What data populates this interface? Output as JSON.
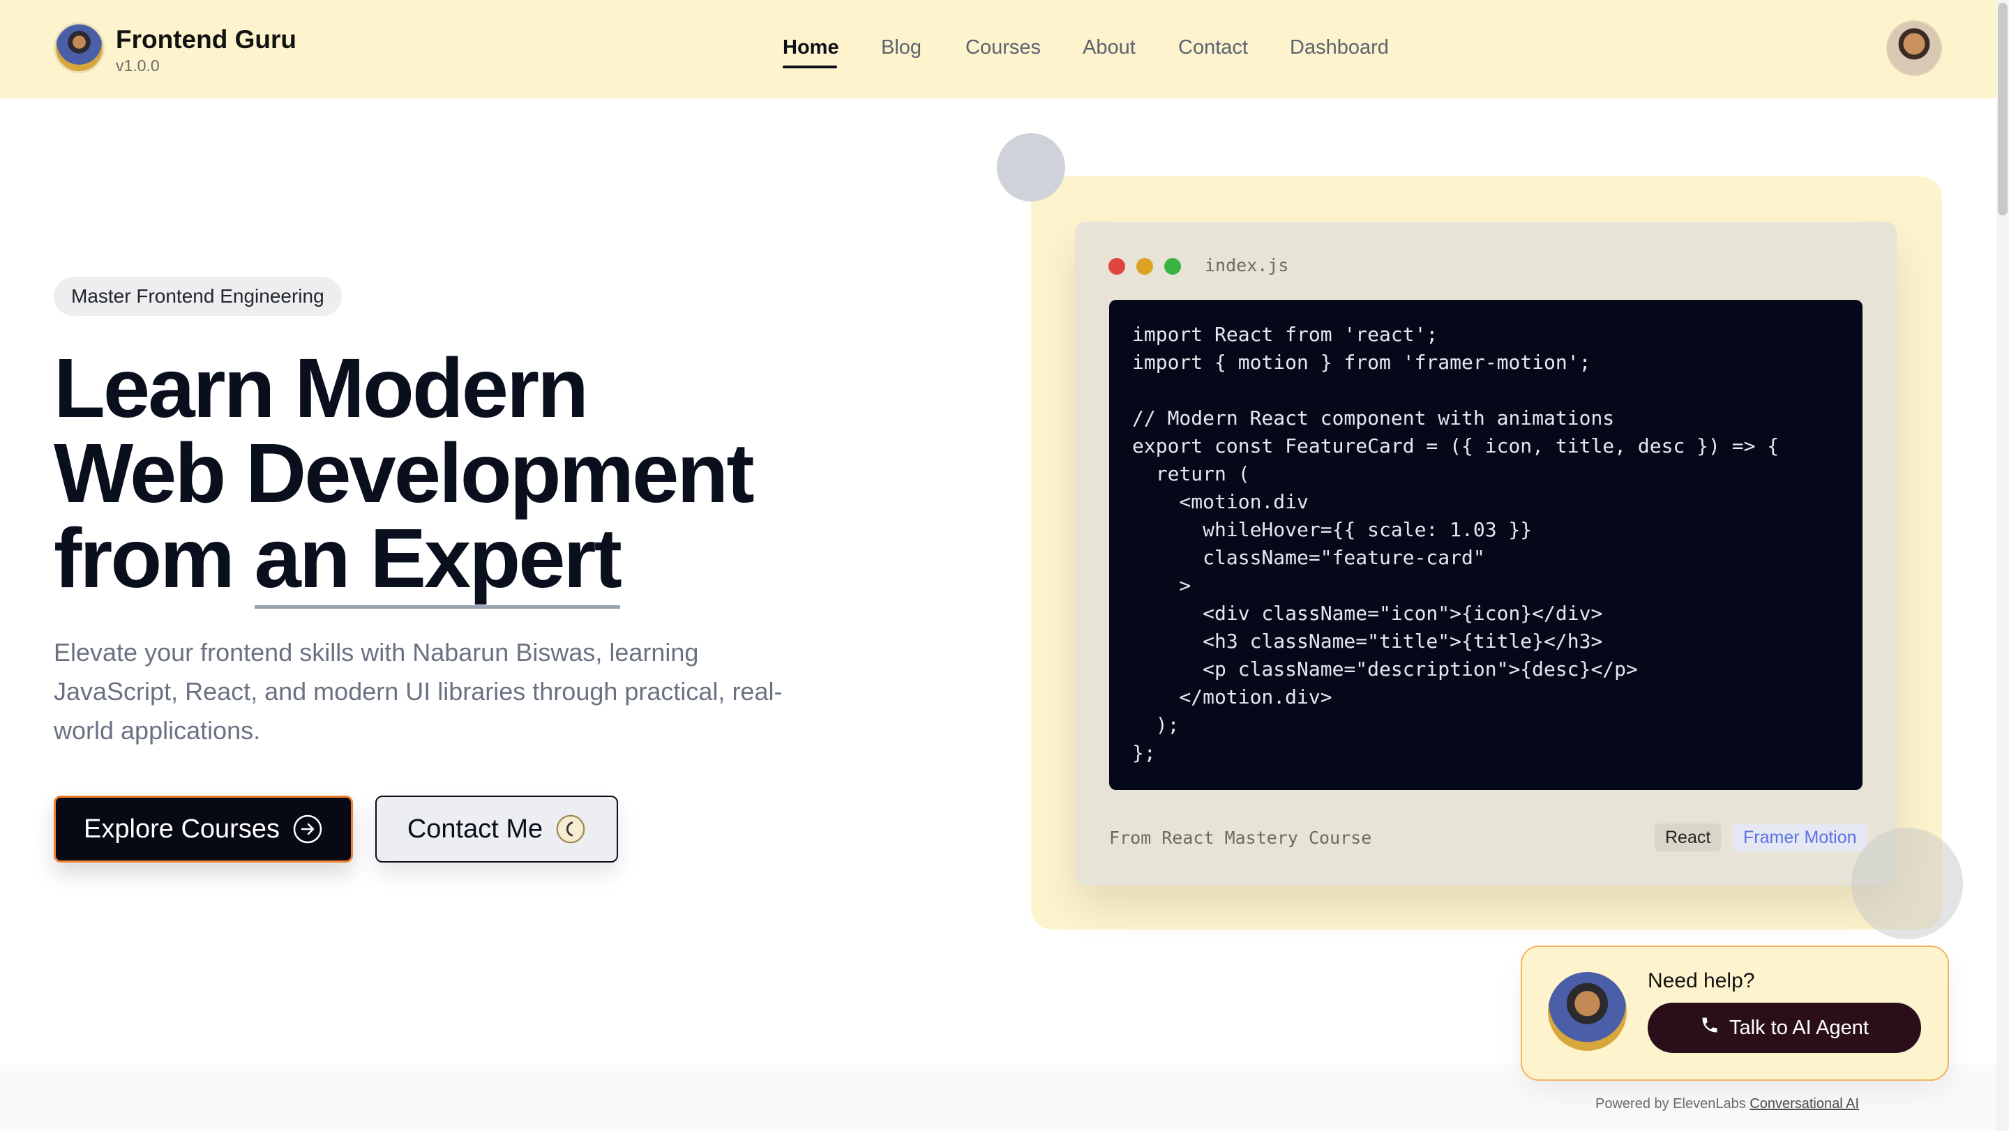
{
  "brand": {
    "name": "Frontend Guru",
    "version": "v1.0.0"
  },
  "nav": {
    "items": [
      {
        "label": "Home",
        "active": true
      },
      {
        "label": "Blog",
        "active": false
      },
      {
        "label": "Courses",
        "active": false
      },
      {
        "label": "About",
        "active": false
      },
      {
        "label": "Contact",
        "active": false
      },
      {
        "label": "Dashboard",
        "active": false
      }
    ]
  },
  "hero": {
    "badge": "Master Frontend Engineering",
    "headline": {
      "line1": "Learn Modern",
      "line2": "Web Development",
      "line3_start": "from ",
      "line3_highlight": "an Expert"
    },
    "subtitle": "Elevate your frontend skills with Nabarun Biswas, learning JavaScript, React, and modern UI libraries through practical, real-world applications.",
    "primary_button": "Explore Courses",
    "secondary_button": "Contact Me"
  },
  "code_card": {
    "filename": "index.js",
    "code": "import React from 'react';\nimport { motion } from 'framer-motion';\n\n// Modern React component with animations\nexport const FeatureCard = ({ icon, title, desc }) => {\n  return (\n    <motion.div\n      whileHover={{ scale: 1.03 }}\n      className=\"feature-card\"\n    >\n      <div className=\"icon\">{icon}</div>\n      <h3 className=\"title\">{title}</h3>\n      <p className=\"description\">{desc}</p>\n    </motion.div>\n  );\n};",
    "source": "From React Mastery Course",
    "tags": [
      "React",
      "Framer Motion"
    ]
  },
  "help_widget": {
    "title": "Need help?",
    "button": "Talk to AI Agent",
    "powered_prefix": "Powered by ElevenLabs ",
    "powered_link": "Conversational AI"
  },
  "colors": {
    "header_bg": "#fdf3cc",
    "primary_button_bg": "#070a14",
    "primary_button_border": "#f08132",
    "code_bg": "#050818",
    "dot_red": "#e0443e",
    "dot_yellow": "#dea123",
    "dot_green": "#1aab29"
  }
}
